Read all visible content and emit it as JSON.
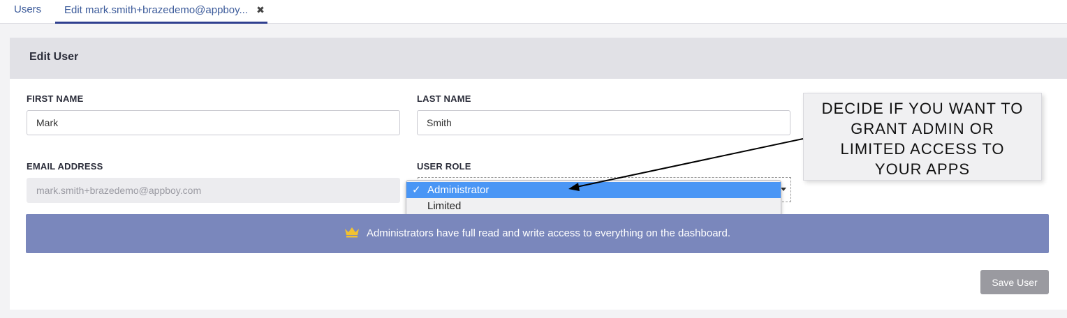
{
  "tabs": {
    "users_label": "Users",
    "edit_label": "Edit mark.smith+brazedemo@appboy...",
    "close_glyph": "✖"
  },
  "panel": {
    "title": "Edit User"
  },
  "form": {
    "first_name_label": "FIRST NAME",
    "first_name_value": "Mark",
    "last_name_label": "LAST NAME",
    "last_name_value": "Smith",
    "email_label": "EMAIL ADDRESS",
    "email_value": "mark.smith+brazedemo@appboy.com",
    "role_label": "USER ROLE",
    "role_options": [
      "Administrator",
      "Limited"
    ],
    "role_selected": "Administrator",
    "check_glyph": "✓"
  },
  "notice": {
    "icon": "crown-icon",
    "text": "Administrators have full read and write access to everything on the dashboard."
  },
  "actions": {
    "save_label": "Save User"
  },
  "callout": {
    "lines": [
      "DECIDE IF YOU WANT TO",
      "GRANT ADMIN OR",
      "LIMITED ACCESS TO",
      "YOUR APPS"
    ]
  },
  "colors": {
    "accent": "#2f3f8f",
    "notice_bg": "#7a87bc",
    "selected_option": "#4a96f5",
    "crown": "#f2c230"
  }
}
